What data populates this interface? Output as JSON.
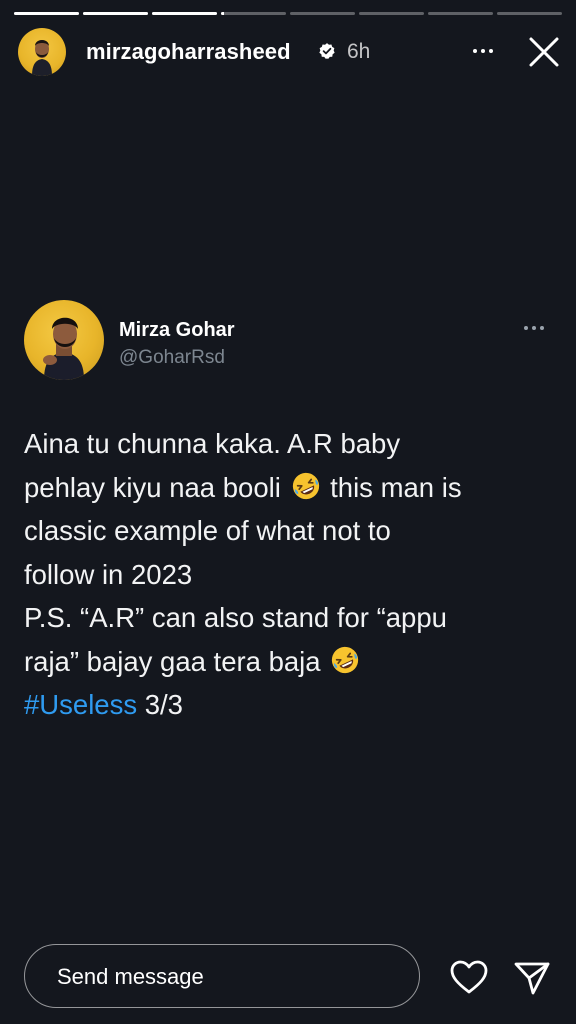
{
  "story": {
    "segments": [
      {
        "fill": 1
      },
      {
        "fill": 1
      },
      {
        "fill": 1
      },
      {
        "fill": 0.05
      },
      {
        "fill": 0
      },
      {
        "fill": 0
      },
      {
        "fill": 0
      },
      {
        "fill": 0
      }
    ],
    "username": "mirzagoharrasheed",
    "time": "6h",
    "verified": true
  },
  "tweet": {
    "display_name": "Mirza Gohar",
    "handle": "@GoharRsd",
    "lines": {
      "l1": "Aina tu chunna kaka. A.R baby",
      "l2a": "pehlay kiyu naa booli",
      "l2b": "this man is",
      "l3": "classic example of what not to",
      "l4": "follow in 2023",
      "l5": "P.S. “A.R” can also stand for “appu",
      "l6": "raja” bajay gaa tera baja",
      "hashtag": "#Useless",
      "tail": " 3/3"
    },
    "emoji": "rolling-on-floor-laughing"
  },
  "reply": {
    "placeholder": "Send message"
  },
  "colors": {
    "background": "#14171e",
    "hashtag": "#2f9bf0",
    "handle": "#7d8690"
  }
}
